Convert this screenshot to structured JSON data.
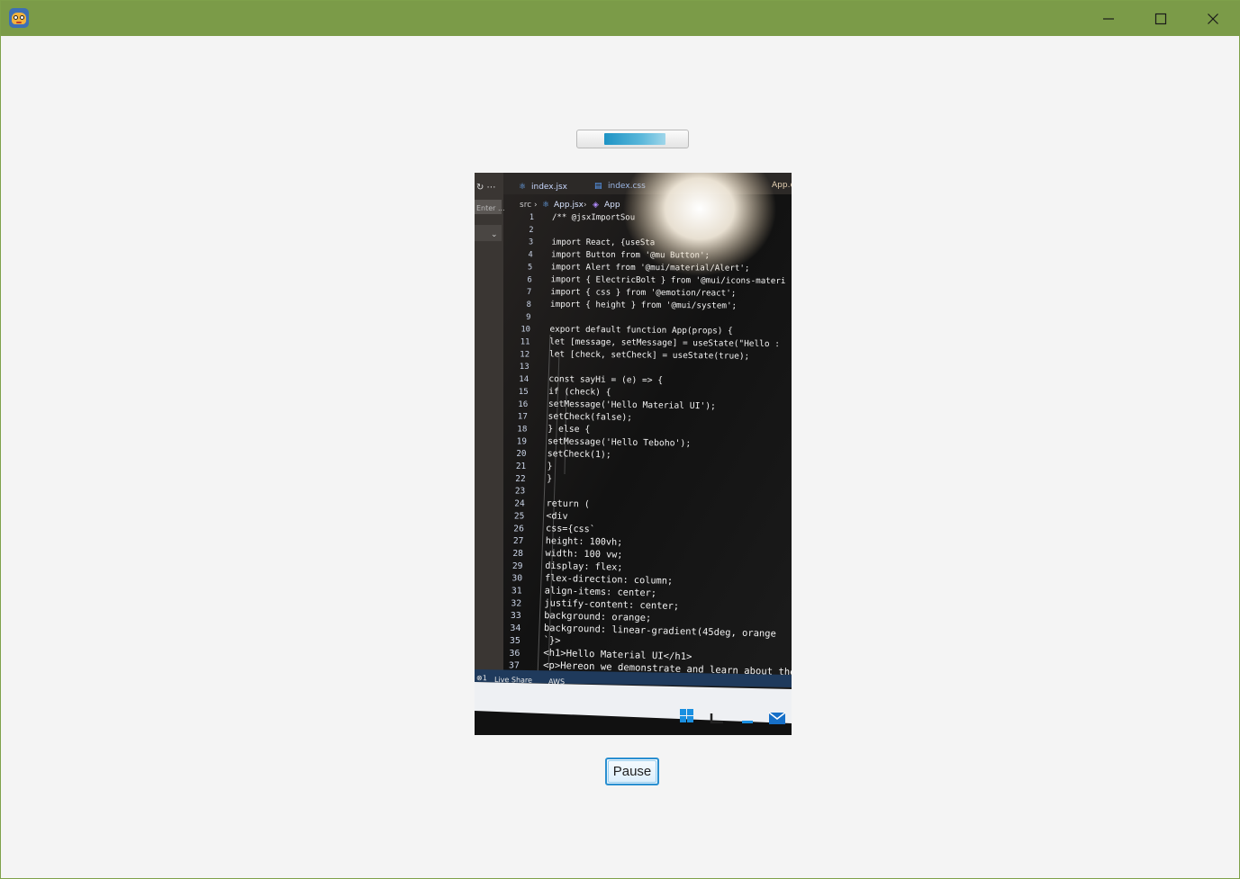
{
  "window": {
    "icon": "monster-app-icon",
    "controls": [
      "minimize-icon",
      "maximize-icon",
      "close-icon"
    ],
    "accent_color": "#7b9b48"
  },
  "playback": {
    "progress_fraction": 0.55,
    "pause_label": "Pause"
  },
  "video_frame": {
    "tabs": [
      "index.jsx",
      "index.css",
      "App.c"
    ],
    "breadcrumb": [
      "src",
      "App.jsx",
      "App"
    ],
    "sidebar_input": "Enter ...",
    "status_items": [
      "Live Share",
      "AWS"
    ],
    "code_lines": [
      {
        "n": "1",
        "t": "/** @jsxImportSou"
      },
      {
        "n": "2",
        "t": ""
      },
      {
        "n": "3",
        "t": "import React, {useSta"
      },
      {
        "n": "4",
        "t": "import Button from '@mu          Button';"
      },
      {
        "n": "5",
        "t": "import Alert from '@mui/material/Alert';"
      },
      {
        "n": "6",
        "t": "import { ElectricBolt } from '@mui/icons-materi"
      },
      {
        "n": "7",
        "t": "import { css } from '@emotion/react';"
      },
      {
        "n": "8",
        "t": "import { height } from '@mui/system';"
      },
      {
        "n": "9",
        "t": ""
      },
      {
        "n": "10",
        "t": "export default function App(props) {"
      },
      {
        "n": "11",
        "t": "  let [message, setMessage] = useState(\"Hello :"
      },
      {
        "n": "12",
        "t": "  let [check, setCheck] = useState(true);"
      },
      {
        "n": "13",
        "t": ""
      },
      {
        "n": "14",
        "t": "  const sayHi = (e) => {"
      },
      {
        "n": "15",
        "t": "    if (check) {"
      },
      {
        "n": "16",
        "t": "      setMessage('Hello Material UI');"
      },
      {
        "n": "17",
        "t": "      setCheck(false);"
      },
      {
        "n": "18",
        "t": "    } else {"
      },
      {
        "n": "19",
        "t": "      setMessage('Hello Teboho');"
      },
      {
        "n": "20",
        "t": "      setCheck(1);"
      },
      {
        "n": "21",
        "t": "    }"
      },
      {
        "n": "22",
        "t": "  }"
      },
      {
        "n": "23",
        "t": ""
      },
      {
        "n": "24",
        "t": "  return ("
      },
      {
        "n": "25",
        "t": "    <div"
      },
      {
        "n": "26",
        "t": "      css={css`"
      },
      {
        "n": "27",
        "t": "        height: 100vh;"
      },
      {
        "n": "28",
        "t": "        width: 100 vw;"
      },
      {
        "n": "29",
        "t": "        display: flex;"
      },
      {
        "n": "30",
        "t": "        flex-direction: column;"
      },
      {
        "n": "31",
        "t": "        align-items: center;"
      },
      {
        "n": "32",
        "t": "        justify-content: center;"
      },
      {
        "n": "33",
        "t": "        background: orange;"
      },
      {
        "n": "34",
        "t": "        background: linear-gradient(45deg, orange"
      },
      {
        "n": "35",
        "t": "      `}>"
      },
      {
        "n": "36",
        "t": "      <h1>Hello Material UI</h1>"
      },
      {
        "n": "37",
        "t": "      <p>Hereon we demonstrate and learn about the"
      }
    ]
  }
}
